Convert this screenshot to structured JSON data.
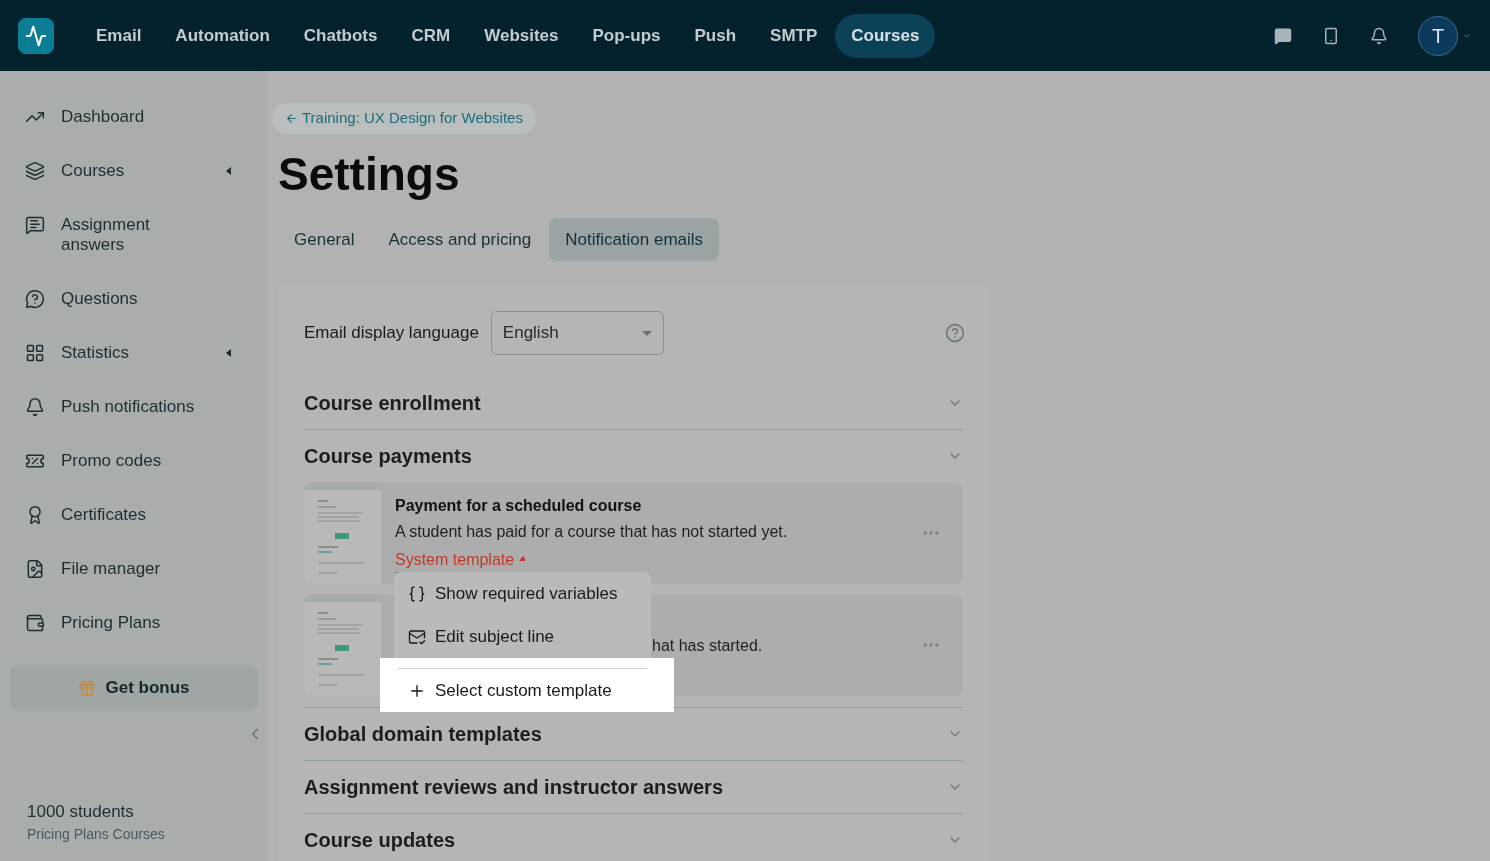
{
  "nav": {
    "items": [
      {
        "label": "Email",
        "selected": false
      },
      {
        "label": "Automation",
        "selected": false
      },
      {
        "label": "Chatbots",
        "selected": false
      },
      {
        "label": "CRM",
        "selected": false
      },
      {
        "label": "Websites",
        "selected": false
      },
      {
        "label": "Pop-ups",
        "selected": false
      },
      {
        "label": "Push",
        "selected": false
      },
      {
        "label": "SMTP",
        "selected": false
      },
      {
        "label": "Courses",
        "selected": true
      }
    ],
    "avatar": "T"
  },
  "sidebar": {
    "items": [
      {
        "label": "Dashboard",
        "kind": "chart",
        "has_submenu": false
      },
      {
        "label": "Courses",
        "kind": "courses",
        "has_submenu": true
      },
      {
        "label": "Assignment answers",
        "kind": "answers",
        "has_submenu": false
      },
      {
        "label": "Questions",
        "kind": "question",
        "has_submenu": false
      },
      {
        "label": "Statistics",
        "kind": "stats",
        "has_submenu": true
      },
      {
        "label": "Push notifications",
        "kind": "bell",
        "has_submenu": false
      },
      {
        "label": "Promo codes",
        "kind": "promo",
        "has_submenu": false
      },
      {
        "label": "Certificates",
        "kind": "certificate",
        "has_submenu": false
      },
      {
        "label": "File manager",
        "kind": "file",
        "has_submenu": false
      },
      {
        "label": "Pricing Plans",
        "kind": "wallet",
        "has_submenu": false
      }
    ],
    "bonus_button": "Get bonus",
    "plan": {
      "students": "1000 students",
      "name": "Pricing Plans Courses"
    }
  },
  "breadcrumb": "Training: UX Design for Websites",
  "title": "Settings",
  "tabs": [
    {
      "label": "General",
      "selected": false
    },
    {
      "label": "Access and pricing",
      "selected": false
    },
    {
      "label": "Notification emails",
      "selected": true
    }
  ],
  "language": {
    "label": "Email display language",
    "value": "English"
  },
  "sections": [
    {
      "title": "Course enrollment"
    },
    {
      "title": "Course payments",
      "templates": [
        {
          "title": "Payment for a scheduled course",
          "description": "A student has paid for a course that has not started yet.",
          "template_label": "System template",
          "menu": {
            "items": [
              {
                "kind": "variables",
                "label": "Show required variables",
                "highlighted": false
              },
              {
                "kind": "subject",
                "label": "Edit subject line",
                "highlighted": false
              },
              {
                "kind": "custom",
                "label": "Select custom template",
                "highlighted": true
              }
            ]
          }
        },
        {
          "description": "hat has started."
        }
      ]
    },
    {
      "title": "Global domain templates"
    },
    {
      "title": "Assignment reviews and instructor answers"
    },
    {
      "title": "Course updates"
    }
  ]
}
